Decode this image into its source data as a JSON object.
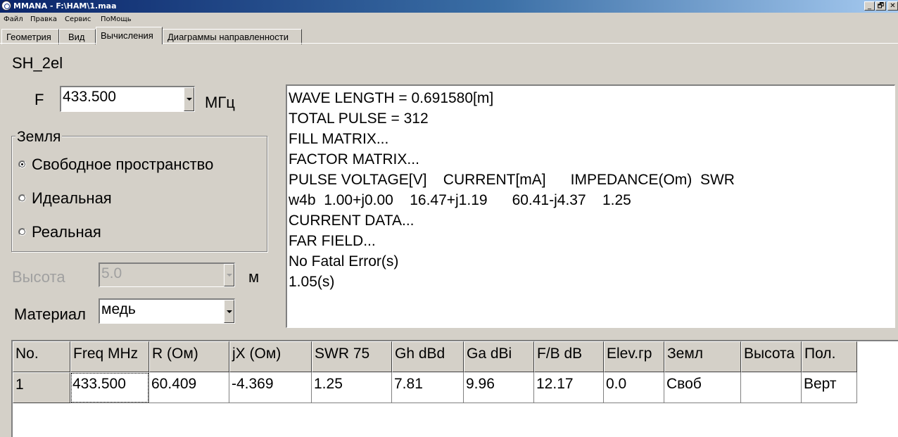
{
  "window": {
    "title": "MMANA - F:\\HAM\\1.maa",
    "buttons": [
      "_",
      "🗗",
      "✕"
    ]
  },
  "menu": [
    "Файл",
    "Правка",
    "Сервис",
    "ПоМощь"
  ],
  "tabs": [
    {
      "label": "Геометрия",
      "active": false
    },
    {
      "label": "Вид",
      "active": false
    },
    {
      "label": "Вычисления",
      "active": true
    },
    {
      "label": "Диаграммы направленности",
      "active": false
    }
  ],
  "antenna_name": "SH_2el",
  "frequency": {
    "label": "F",
    "value": "433.500",
    "unit": "МГц"
  },
  "ground": {
    "title": "Земля",
    "options": [
      {
        "label": "Свободное пространство",
        "checked": true
      },
      {
        "label": "Идеальная",
        "checked": false
      },
      {
        "label": "Реальная",
        "checked": false
      }
    ]
  },
  "height": {
    "label": "Высота",
    "value": "5.0",
    "unit": "м",
    "enabled": false
  },
  "material": {
    "label": "Материал",
    "value": "медь"
  },
  "output_lines": [
    "WAVE LENGTH = 0.691580[m]",
    "TOTAL PULSE = 312",
    "FILL MATRIX...",
    "FACTOR MATRIX...",
    "PULSE VOLTAGE[V]    CURRENT[mA]      IMPEDANCE(Om)  SWR",
    "w4b  1.00+j0.00    16.47+j1.19      60.41-j4.37    1.25",
    "CURRENT DATA...",
    "FAR FIELD...",
    "No Fatal Error(s)",
    "1.05(s)"
  ],
  "table": {
    "headers": [
      "No.",
      "Freq MHz",
      "R (Ом)",
      "jX (Ом)",
      "SWR 75",
      "Gh dBd",
      "Ga dBi",
      "F/B dB",
      "Elev.гр",
      "Земл",
      "Высота",
      "Пол."
    ],
    "rows": [
      [
        "1",
        "433.500",
        "60.409",
        "-4.369",
        "1.25",
        "7.81",
        "9.96",
        "12.17",
        "0.0",
        "Своб",
        "",
        "Верт"
      ]
    ]
  }
}
